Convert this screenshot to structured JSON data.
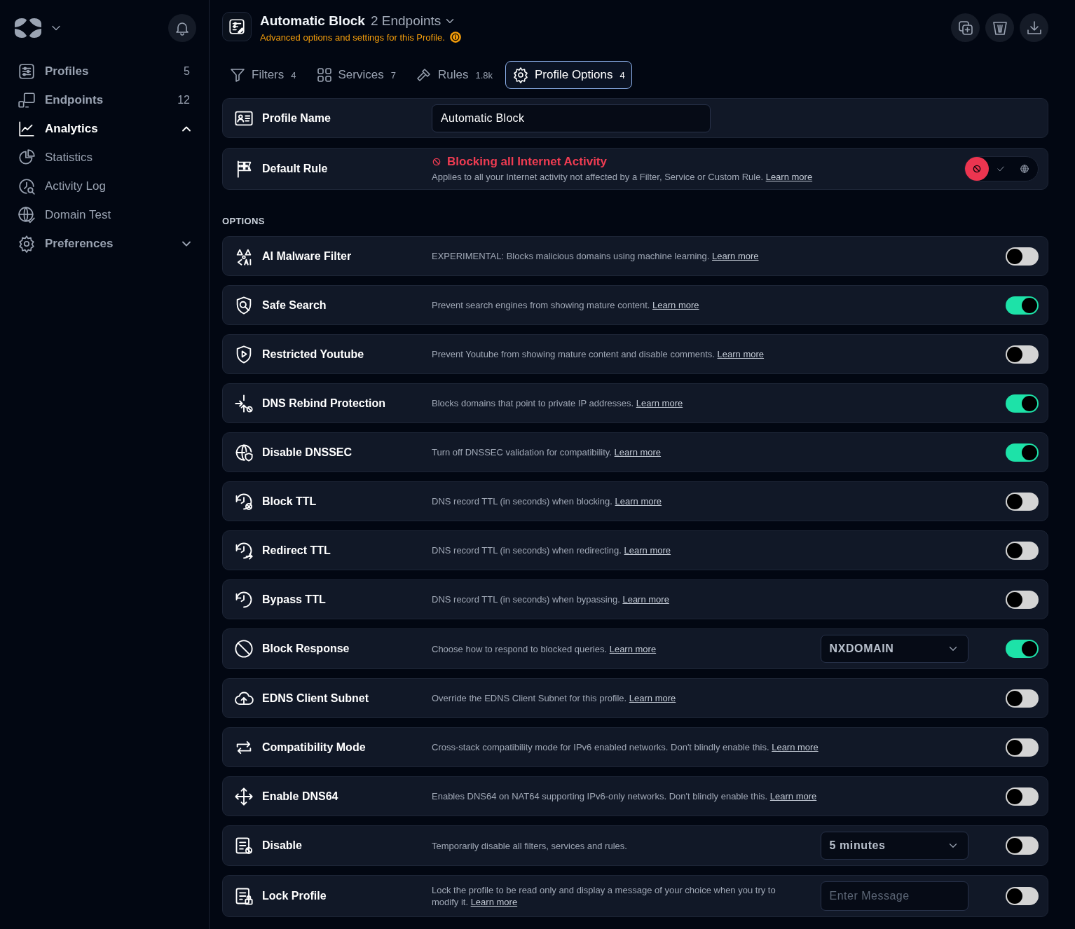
{
  "sidebar": {
    "items": [
      {
        "label": "Profiles",
        "count": "5",
        "selected": false
      },
      {
        "label": "Endpoints",
        "count": "12",
        "selected": false
      },
      {
        "label": "Analytics",
        "selected": true,
        "expanded": true,
        "children": [
          {
            "label": "Statistics",
            "selected": false
          },
          {
            "label": "Activity Log",
            "selected": false
          },
          {
            "label": "Domain Test",
            "selected": false
          }
        ]
      },
      {
        "label": "Preferences",
        "selected": false,
        "expanded": false
      }
    ]
  },
  "header": {
    "title": "Automatic Block",
    "endpoints": "2 Endpoints",
    "subtitle": "Advanced options and settings for this Profile."
  },
  "tabs": [
    {
      "label": "Filters",
      "count": "4",
      "selected": false
    },
    {
      "label": "Services",
      "count": "7",
      "selected": false
    },
    {
      "label": "Rules",
      "count": "1.8k",
      "selected": false
    },
    {
      "label": "Profile Options",
      "count": "4",
      "selected": true
    }
  ],
  "profile_name": {
    "label": "Profile Name",
    "value": "Automatic Block"
  },
  "default_rule": {
    "label": "Default Rule",
    "status": "Blocking all Internet Activity",
    "description": "Applies to all your Internet activity not affected by a Filter, Service or Custom Rule.",
    "link": "Learn more",
    "options": [
      {
        "kind": "block",
        "selected": true
      },
      {
        "kind": "allow",
        "selected": false
      },
      {
        "kind": "redirect",
        "selected": false
      }
    ]
  },
  "options_heading": "OPTIONS",
  "options": [
    {
      "label": "AI Malware Filter",
      "description": "EXPERIMENTAL: Blocks malicious domains using machine learning.",
      "link": "Learn more",
      "on": false
    },
    {
      "label": "Safe Search",
      "description": "Prevent search engines from showing mature content.",
      "link": "Learn more",
      "on": true
    },
    {
      "label": "Restricted Youtube",
      "description": "Prevent Youtube from showing mature content and disable comments.",
      "link": "Learn more",
      "on": false
    },
    {
      "label": "DNS Rebind Protection",
      "description": "Blocks domains that point to private IP addresses.",
      "link": "Learn more",
      "on": true
    },
    {
      "label": "Disable DNSSEC",
      "description": "Turn off DNSSEC validation for compatibility.",
      "link": "Learn more",
      "on": true
    },
    {
      "label": "Block TTL",
      "description": "DNS record TTL (in seconds) when blocking.",
      "link": "Learn more",
      "on": false
    },
    {
      "label": "Redirect TTL",
      "description": "DNS record TTL (in seconds) when redirecting.",
      "link": "Learn more",
      "on": false
    },
    {
      "label": "Bypass TTL",
      "description": "DNS record TTL (in seconds) when bypassing.",
      "link": "Learn more",
      "on": false
    },
    {
      "label": "Block Response",
      "description": "Choose how to respond to blocked queries.",
      "link": "Learn more",
      "on": true,
      "control": {
        "kind": "select",
        "value": "NXDOMAIN"
      }
    },
    {
      "label": "EDNS Client Subnet",
      "description": "Override the EDNS Client Subnet for this profile.",
      "link": "Learn more",
      "on": false
    },
    {
      "label": "Compatibility Mode",
      "description": "Cross-stack compatibility mode for IPv6 enabled networks. Don't blindly enable this.",
      "link": "Learn more",
      "on": false
    },
    {
      "label": "Enable DNS64",
      "description": "Enables DNS64 on NAT64 supporting IPv6-only networks. Don't blindly enable this.",
      "link": "Learn more",
      "on": false
    },
    {
      "label": "Disable",
      "description": "Temporarily disable all filters, services and rules.",
      "on": false,
      "control": {
        "kind": "select",
        "value": "5 minutes"
      }
    },
    {
      "label": "Lock Profile",
      "description": "Lock the profile to be read only and display a message of your choice when you try to modify it.",
      "link": "Learn more",
      "on": false,
      "control": {
        "kind": "input",
        "placeholder": "Enter Message"
      }
    }
  ]
}
